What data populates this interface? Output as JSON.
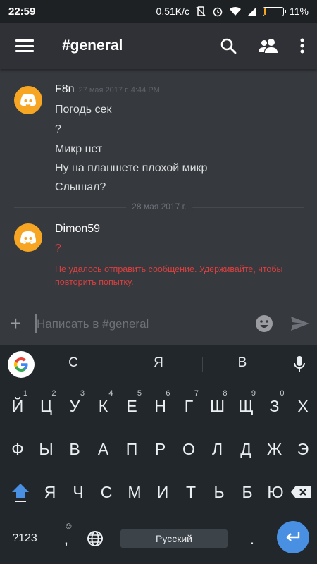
{
  "status_bar": {
    "time": "22:59",
    "net_speed": "0,51K/c",
    "battery": "11%",
    "battery_level": 0.11
  },
  "header": {
    "channel": "#general",
    "icons": [
      "menu-icon",
      "search-icon",
      "members-icon",
      "more-vert-icon"
    ]
  },
  "messages": [
    {
      "author": "F8n",
      "timestamp": "27 мая 2017 г. 4:44 PM",
      "lines": [
        "Погодь сек",
        "?",
        "Микр нет",
        "Ну на планшете плохой  микр",
        "Слышал?"
      ]
    },
    {
      "author": "Dimon59",
      "lines": [
        "?"
      ],
      "error": "Не удалось отправить сообщение. Удерживайте, чтобы повторить попытку."
    }
  ],
  "date_divider": "28 мая 2017 г.",
  "composer": {
    "placeholder": "Написать в #general"
  },
  "keyboard": {
    "suggestions": [
      "С",
      "Я",
      "В"
    ],
    "row1": [
      "Й",
      "Ц",
      "У",
      "К",
      "Е",
      "Н",
      "Г",
      "Ш",
      "Щ",
      "З",
      "Х"
    ],
    "row1_hints": [
      "1",
      "2",
      "3",
      "4",
      "5",
      "6",
      "7",
      "8",
      "9",
      "0",
      ""
    ],
    "row2": [
      "Ф",
      "Ы",
      "В",
      "А",
      "П",
      "Р",
      "О",
      "Л",
      "Д",
      "Ж",
      "Э"
    ],
    "row3": [
      "Я",
      "Ч",
      "С",
      "М",
      "И",
      "Т",
      "Ь",
      "Б",
      "Ю"
    ],
    "symbols_label": "?123",
    "comma": ",",
    "period": ".",
    "space_label": "Русский",
    "colors": {
      "enter": "#4a90e2",
      "shift": "#4a90e2"
    }
  },
  "colors": {
    "avatar": "#f6a623",
    "error": "#d84040",
    "background": "#36393e",
    "header": "#2f3136"
  }
}
